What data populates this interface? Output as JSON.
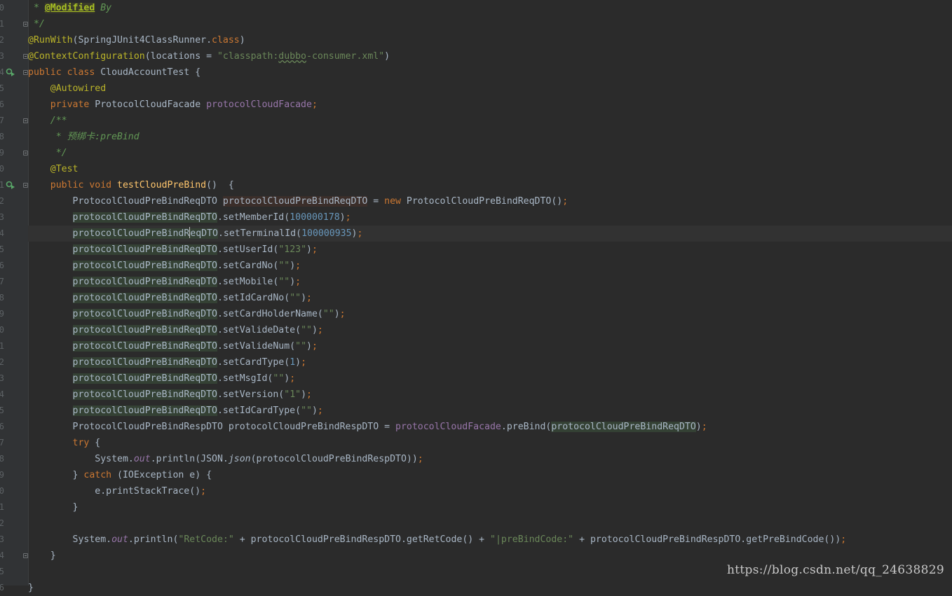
{
  "editor": {
    "line_numbers": [
      "0",
      "1",
      "2",
      "3",
      "4",
      "5",
      "6",
      "7",
      "8",
      "9",
      "0",
      "1",
      "2",
      "3",
      "4",
      "5",
      "6",
      "7",
      "8",
      "9",
      "0",
      "1",
      "2",
      "3",
      "4",
      "5",
      "6",
      "7",
      "8",
      "9",
      "0",
      "1",
      "2",
      "3",
      "4",
      "5",
      "6"
    ],
    "lines": [
      [
        {
          "c": "cmt",
          "v": " * "
        },
        {
          "c": "mod",
          "v": "@Modified"
        },
        {
          "c": "cmt",
          "v": " By"
        }
      ],
      [
        {
          "c": "cmt",
          "v": " */"
        }
      ],
      [
        {
          "c": "ann",
          "v": "@RunWith"
        },
        {
          "c": "",
          "v": "(SpringJUnit4ClassRunner."
        },
        {
          "c": "kw",
          "v": "class"
        },
        {
          "c": "",
          "v": ")"
        }
      ],
      [
        {
          "c": "ann",
          "v": "@ContextConfiguration"
        },
        {
          "c": "",
          "v": "(locations = "
        },
        {
          "c": "str",
          "v": "\"classpath:"
        },
        {
          "c": "str wavy",
          "v": "dubbo"
        },
        {
          "c": "str",
          "v": "-consumer.xml\""
        },
        {
          "c": "",
          "v": ")"
        }
      ],
      [
        {
          "c": "kw",
          "v": "public class "
        },
        {
          "c": "",
          "v": "CloudAccountTest {"
        }
      ],
      [
        {
          "c": "ann",
          "v": "    @Autowired"
        }
      ],
      [
        {
          "c": "kw",
          "v": "    private "
        },
        {
          "c": "",
          "v": "ProtocolCloudFacade "
        },
        {
          "c": "field",
          "v": "protocolCloudFacade"
        },
        {
          "c": "kw",
          "v": ";"
        }
      ],
      [
        {
          "c": "cmt",
          "v": "    /**"
        }
      ],
      [
        {
          "c": "cmt",
          "v": "     * 预绑卡:preBind"
        }
      ],
      [
        {
          "c": "cmt",
          "v": "     */"
        }
      ],
      [
        {
          "c": "ann",
          "v": "    @Test"
        }
      ],
      [
        {
          "c": "kw",
          "v": "    public void "
        },
        {
          "c": "fn",
          "v": "testCloudPreBind"
        },
        {
          "c": "",
          "v": "()  {"
        }
      ],
      [
        {
          "c": "",
          "v": "        ProtocolCloudPreBindReqDTO "
        },
        {
          "c": "hl2",
          "v": "protocolCloudPreBindReqDTO"
        },
        {
          "c": "",
          "v": " = "
        },
        {
          "c": "kw",
          "v": "new "
        },
        {
          "c": "",
          "v": "ProtocolCloudPreBindReqDTO()"
        },
        {
          "c": "kw",
          "v": ";"
        }
      ],
      [
        {
          "c": "",
          "v": "        "
        },
        {
          "c": "hl",
          "v": "protocolCloudPreBindReqDTO"
        },
        {
          "c": "",
          "v": ".setMemberId("
        },
        {
          "c": "num",
          "v": "100000178"
        },
        {
          "c": "",
          "v": ")"
        },
        {
          "c": "kw",
          "v": ";"
        }
      ],
      [
        {
          "c": "",
          "v": "        "
        },
        {
          "c": "hl",
          "v": "protocolCloudPreBindR"
        },
        {
          "c": "caret",
          "v": ""
        },
        {
          "c": "hl",
          "v": "eqDTO"
        },
        {
          "c": "",
          "v": ".setTerminalId("
        },
        {
          "c": "num",
          "v": "100000935"
        },
        {
          "c": "",
          "v": ")"
        },
        {
          "c": "kw",
          "v": ";"
        }
      ],
      [
        {
          "c": "",
          "v": "        "
        },
        {
          "c": "hl",
          "v": "protocolCloudPreBindReqDTO"
        },
        {
          "c": "",
          "v": ".setUserId("
        },
        {
          "c": "str",
          "v": "\"123\""
        },
        {
          "c": "",
          "v": ")"
        },
        {
          "c": "kw",
          "v": ";"
        }
      ],
      [
        {
          "c": "",
          "v": "        "
        },
        {
          "c": "hl",
          "v": "protocolCloudPreBindReqDTO"
        },
        {
          "c": "",
          "v": ".setCardNo("
        },
        {
          "c": "str",
          "v": "\"\""
        },
        {
          "c": "",
          "v": ")"
        },
        {
          "c": "kw",
          "v": ";"
        }
      ],
      [
        {
          "c": "",
          "v": "        "
        },
        {
          "c": "hl",
          "v": "protocolCloudPreBindReqDTO"
        },
        {
          "c": "",
          "v": ".setMobile("
        },
        {
          "c": "str",
          "v": "\"\""
        },
        {
          "c": "",
          "v": ")"
        },
        {
          "c": "kw",
          "v": ";"
        }
      ],
      [
        {
          "c": "",
          "v": "        "
        },
        {
          "c": "hl",
          "v": "protocolCloudPreBindReqDTO"
        },
        {
          "c": "",
          "v": ".setIdCardNo("
        },
        {
          "c": "str",
          "v": "\"\""
        },
        {
          "c": "",
          "v": ")"
        },
        {
          "c": "kw",
          "v": ";"
        }
      ],
      [
        {
          "c": "",
          "v": "        "
        },
        {
          "c": "hl",
          "v": "protocolCloudPreBindReqDTO"
        },
        {
          "c": "",
          "v": ".setCardHolderName("
        },
        {
          "c": "str",
          "v": "\"\""
        },
        {
          "c": "",
          "v": ")"
        },
        {
          "c": "kw",
          "v": ";"
        }
      ],
      [
        {
          "c": "",
          "v": "        "
        },
        {
          "c": "hl",
          "v": "protocolCloudPreBindReqDTO"
        },
        {
          "c": "",
          "v": ".setValideDate("
        },
        {
          "c": "str",
          "v": "\"\""
        },
        {
          "c": "",
          "v": ")"
        },
        {
          "c": "kw",
          "v": ";"
        }
      ],
      [
        {
          "c": "",
          "v": "        "
        },
        {
          "c": "hl",
          "v": "protocolCloudPreBindReqDTO"
        },
        {
          "c": "",
          "v": ".setValideNum("
        },
        {
          "c": "str",
          "v": "\"\""
        },
        {
          "c": "",
          "v": ")"
        },
        {
          "c": "kw",
          "v": ";"
        }
      ],
      [
        {
          "c": "",
          "v": "        "
        },
        {
          "c": "hl",
          "v": "protocolCloudPreBindReqDTO"
        },
        {
          "c": "",
          "v": ".setCardType("
        },
        {
          "c": "num",
          "v": "1"
        },
        {
          "c": "",
          "v": ")"
        },
        {
          "c": "kw",
          "v": ";"
        }
      ],
      [
        {
          "c": "",
          "v": "        "
        },
        {
          "c": "hl",
          "v": "protocolCloudPreBindReqDTO"
        },
        {
          "c": "",
          "v": ".setMsgId("
        },
        {
          "c": "str",
          "v": "\"\""
        },
        {
          "c": "",
          "v": ")"
        },
        {
          "c": "kw",
          "v": ";"
        }
      ],
      [
        {
          "c": "",
          "v": "        "
        },
        {
          "c": "hl",
          "v": "protocolCloudPreBindReqDTO"
        },
        {
          "c": "",
          "v": ".setVersion("
        },
        {
          "c": "str",
          "v": "\"1\""
        },
        {
          "c": "",
          "v": ")"
        },
        {
          "c": "kw",
          "v": ";"
        }
      ],
      [
        {
          "c": "",
          "v": "        "
        },
        {
          "c": "hl",
          "v": "protocolCloudPreBindReqDTO"
        },
        {
          "c": "",
          "v": ".setIdCardType("
        },
        {
          "c": "str",
          "v": "\"\""
        },
        {
          "c": "",
          "v": ")"
        },
        {
          "c": "kw",
          "v": ";"
        }
      ],
      [
        {
          "c": "",
          "v": "        ProtocolCloudPreBindRespDTO protocolCloudPreBindRespDTO = "
        },
        {
          "c": "field",
          "v": "protocolCloudFacade"
        },
        {
          "c": "",
          "v": ".preBind("
        },
        {
          "c": "hl",
          "v": "protocolCloudPreBindReqDTO"
        },
        {
          "c": "",
          "v": ")"
        },
        {
          "c": "kw",
          "v": ";"
        }
      ],
      [
        {
          "c": "kw",
          "v": "        try "
        },
        {
          "c": "",
          "v": "{"
        }
      ],
      [
        {
          "c": "",
          "v": "            System."
        },
        {
          "c": "static",
          "v": "out"
        },
        {
          "c": "",
          "v": ".println(JSON."
        },
        {
          "c": "",
          "v": "json",
          "i": true
        },
        {
          "c": "",
          "v": "(protocolCloudPreBindRespDTO))"
        },
        {
          "c": "kw",
          "v": ";"
        }
      ],
      [
        {
          "c": "",
          "v": "        } "
        },
        {
          "c": "kw",
          "v": "catch "
        },
        {
          "c": "",
          "v": "(IOException e) {"
        }
      ],
      [
        {
          "c": "",
          "v": "            e.printStackTrace()"
        },
        {
          "c": "kw",
          "v": ";"
        }
      ],
      [
        {
          "c": "",
          "v": "        }"
        }
      ],
      [
        {
          "c": "",
          "v": ""
        }
      ],
      [
        {
          "c": "",
          "v": "        System."
        },
        {
          "c": "static",
          "v": "out"
        },
        {
          "c": "",
          "v": ".println("
        },
        {
          "c": "str",
          "v": "\"RetCode:\""
        },
        {
          "c": "",
          "v": " + protocolCloudPreBindRespDTO.getRetCode() + "
        },
        {
          "c": "str",
          "v": "\"|preBindCode:\""
        },
        {
          "c": "",
          "v": " + protocolCloudPreBindRespDTO.getPreBindCode())"
        },
        {
          "c": "kw",
          "v": ";"
        }
      ],
      [
        {
          "c": "",
          "v": "    }"
        }
      ],
      [
        {
          "c": "",
          "v": ""
        }
      ],
      [
        {
          "c": "",
          "v": "}"
        }
      ]
    ],
    "current_line": 14
  },
  "watermark": "https://blog.csdn.net/qq_24638829",
  "colors": {
    "background": "#2b2b2b",
    "gutter": "#313335",
    "keyword": "#cc7832",
    "annotation": "#bbb529",
    "string": "#6a8759",
    "number": "#6897bb",
    "field": "#9876aa",
    "method_decl": "#ffc66d",
    "text": "#a9b7c6"
  },
  "gutter_icons": [
    "run-test-icon-class",
    "run-test-icon-method"
  ]
}
